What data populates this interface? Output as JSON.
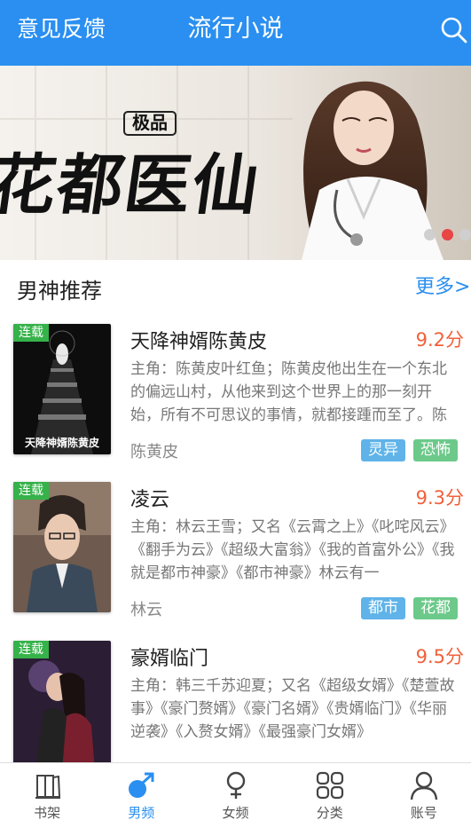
{
  "header": {
    "feedback": "意见反馈",
    "title": "流行小说",
    "search_icon": "search-icon"
  },
  "banner": {
    "title_small": "极品",
    "title_main": "花都医仙",
    "slide_count": 3,
    "active_slide": 2
  },
  "section": {
    "title": "男神推荐",
    "more": "更多>"
  },
  "books": [
    {
      "badge": "连载",
      "name": "天降神婿陈黄皮",
      "score": "9.2分",
      "desc": "主角：陈黄皮叶红鱼；陈黄皮他出生在一个东北的偏远山村，从他来到这个世界上的那一刻开始，所有不可思议的事情，就都接踵而至了。陈",
      "author": "陈黄皮",
      "cover_text": "天降神婿陈黄皮",
      "tags": [
        {
          "text": "灵异",
          "color": "blue"
        },
        {
          "text": "恐怖",
          "color": "green"
        }
      ]
    },
    {
      "badge": "连载",
      "name": "凌云",
      "score": "9.3分",
      "desc": "主角：林云王雪；又名《云霄之上》《叱咤风云》《翻手为云》《超级大富翁》《我的首富外公》《我就是都市神豪》《都市神豪》林云有一",
      "author": "林云",
      "cover_text": "",
      "tags": [
        {
          "text": "都市",
          "color": "blue"
        },
        {
          "text": "花都",
          "color": "green"
        }
      ]
    },
    {
      "badge": "连载",
      "name": "豪婿临门",
      "score": "9.5分",
      "desc": "主角：韩三千苏迎夏；又名《超级女婿》《楚萱故事》《豪门赘婿》《豪门名婿》《贵婿临门》《华丽逆袭》《入赘女婿》《最强豪门女婿》",
      "author": "",
      "cover_text": "",
      "tags": []
    }
  ],
  "tabbar": [
    {
      "label": "书架",
      "icon": "bookshelf-icon",
      "active": false
    },
    {
      "label": "男频",
      "icon": "male-icon",
      "active": true
    },
    {
      "label": "女频",
      "icon": "female-icon",
      "active": false
    },
    {
      "label": "分类",
      "icon": "category-grid-icon",
      "active": false
    },
    {
      "label": "账号",
      "icon": "account-icon",
      "active": false
    }
  ],
  "colors": {
    "primary": "#2a8ff0",
    "score": "#f2603a",
    "serial_badge": "#36b24a"
  }
}
